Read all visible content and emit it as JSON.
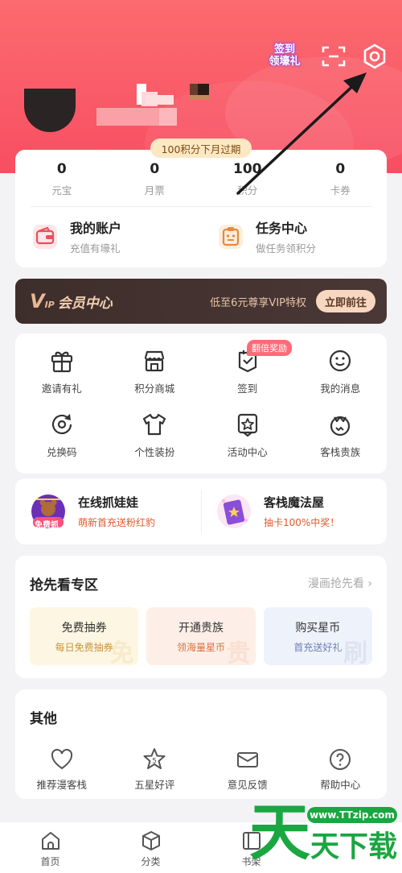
{
  "header": {
    "signin_line1": "签到",
    "signin_line2": "领壕礼",
    "expire_badge": "100积分下月过期"
  },
  "stats": [
    {
      "value": "0",
      "label": "元宝"
    },
    {
      "value": "0",
      "label": "月票"
    },
    {
      "value": "100",
      "label": "积分"
    },
    {
      "value": "0",
      "label": "卡券"
    }
  ],
  "quick": {
    "account_title": "我的账户",
    "account_sub": "充值有壕礼",
    "task_title": "任务中心",
    "task_sub": "做任务领积分"
  },
  "vip": {
    "logo": "V",
    "logo_small": "IP",
    "title": "会员中心",
    "desc": "低至6元尊享VIP特权",
    "button": "立即前往"
  },
  "grid": {
    "badge": "翻倍奖励",
    "items": [
      {
        "label": "邀请有礼",
        "icon": "gift-icon"
      },
      {
        "label": "积分商城",
        "icon": "store-icon"
      },
      {
        "label": "签到",
        "icon": "checkin-icon"
      },
      {
        "label": "我的消息",
        "icon": "smile-message-icon"
      },
      {
        "label": "兑换码",
        "icon": "redeem-code-icon"
      },
      {
        "label": "个性装扮",
        "icon": "tshirt-icon"
      },
      {
        "label": "活动中心",
        "icon": "star-badge-icon"
      },
      {
        "label": "客栈贵族",
        "icon": "crown-icon"
      }
    ]
  },
  "promo": {
    "left_title": "在线抓娃娃",
    "left_sub": "萌新首充送粉红豹",
    "left_tag": "免费抓",
    "right_title": "客栈魔法屋",
    "right_sub": "抽卡100%中奖！"
  },
  "preview": {
    "title": "抢先看专区",
    "more": "漫画抢先看",
    "tiles": [
      {
        "title": "免费抽券",
        "sub": "每日免费抽券",
        "mark": "免"
      },
      {
        "title": "开通贵族",
        "sub": "领海量星币",
        "mark": "贵"
      },
      {
        "title": "购买星币",
        "sub": "首充送好礼",
        "mark": "刷"
      }
    ]
  },
  "other": {
    "title": "其他",
    "items": [
      {
        "label": "推荐漫客栈",
        "icon": "heart-icon"
      },
      {
        "label": "五星好评",
        "icon": "star-five-icon",
        "num": "5"
      },
      {
        "label": "意见反馈",
        "icon": "envelope-icon"
      },
      {
        "label": "帮助中心",
        "icon": "help-icon"
      }
    ]
  },
  "tabs": [
    {
      "label": "首页",
      "icon": "home-icon"
    },
    {
      "label": "分类",
      "icon": "cube-icon"
    },
    {
      "label": "书架",
      "icon": "bookshelf-icon"
    },
    {
      "label": "",
      "icon": ""
    }
  ],
  "watermark": {
    "url": "www.TTzip.com",
    "chars": [
      "天",
      "天",
      "下",
      "载"
    ]
  },
  "colors": {
    "header": "#f84e62",
    "vip_bg": "#3d2d2b",
    "accent": "#ff6a77"
  }
}
